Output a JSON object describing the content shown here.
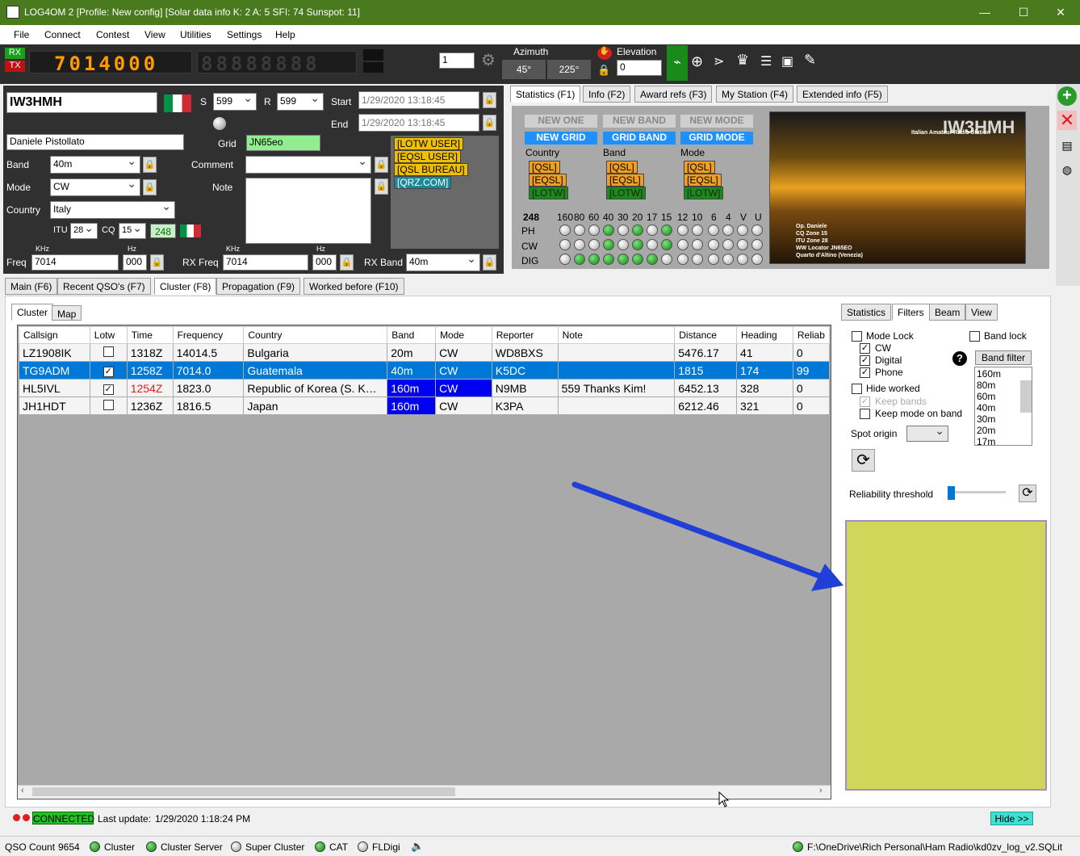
{
  "window": {
    "title": "LOG4OM 2 [Profile: New config] [Solar data info K: 2 A: 5 SFI: 74 Sunspot: 11]",
    "min": "—",
    "max": "☐",
    "close": "✕"
  },
  "menu": [
    "File",
    "Connect",
    "Contest",
    "View",
    "Utilities",
    "Settings",
    "Help"
  ],
  "radio": {
    "rx": "RX",
    "tx": "TX",
    "freq_digits": "7014000",
    "freq2": "88888888",
    "spin": "1",
    "azimuth_label": "Azimuth",
    "az1": "45°",
    "az2": "225°",
    "elevation_label": "Elevation",
    "elevation": "0"
  },
  "qso": {
    "callsign": "IW3HMH",
    "s_label": "S",
    "s": "599",
    "r_label": "R",
    "r": "599",
    "start_label": "Start",
    "start": "1/29/2020 13:18:45",
    "end_label": "End",
    "end": "1/29/2020 13:18:45",
    "name": "Daniele Pistollato",
    "grid_label": "Grid",
    "grid": "JN65eo",
    "band_label": "Band",
    "band": "40m",
    "comment_label": "Comment",
    "comment": "",
    "mode_label": "Mode",
    "mode": "CW",
    "note_label": "Note",
    "country_label": "Country",
    "country": "Italy",
    "itu_label": "ITU",
    "itu": "28",
    "cq_label": "CQ",
    "cq": "15",
    "dxcc": "248",
    "khz": "KHz",
    "hz": "Hz",
    "freq_label": "Freq",
    "freq": "7014",
    "freq_hz": "000",
    "rxfreq_label": "RX Freq",
    "rxfreq": "7014",
    "rxfreq_hz": "000",
    "rxband_label": "RX Band",
    "rxband": "40m",
    "badges": [
      "[LOTW USER]",
      "[EQSL USER]",
      "[QSL BUREAU]",
      "[QRZ.COM]"
    ]
  },
  "right_tabs": [
    "Statistics (F1)",
    "Info (F2)",
    "Award refs (F3)",
    "My Station (F4)",
    "Extended info (F5)"
  ],
  "stats": {
    "new_one": "NEW ONE",
    "new_band": "NEW BAND",
    "new_mode": "NEW MODE",
    "new_grid": "NEW GRID",
    "grid_band": "GRID BAND",
    "grid_mode": "GRID MODE",
    "col_country": "Country",
    "col_band": "Band",
    "col_mode": "Mode",
    "qsl": "[QSL]",
    "eqsl": "[EQSL]",
    "lotw": "[LOTW]",
    "count": "248",
    "bands": [
      "160",
      "80",
      "60",
      "40",
      "30",
      "20",
      "17",
      "15",
      "12",
      "10",
      "6",
      "4",
      "V",
      "U"
    ],
    "rows": [
      {
        "name": "PH",
        "leds": [
          0,
          0,
          0,
          1,
          0,
          1,
          0,
          1,
          0,
          0,
          0,
          0,
          0,
          0
        ]
      },
      {
        "name": "CW",
        "leds": [
          0,
          0,
          0,
          1,
          0,
          1,
          0,
          1,
          0,
          0,
          0,
          0,
          0,
          0
        ]
      },
      {
        "name": "DIG",
        "leds": [
          0,
          1,
          1,
          1,
          1,
          1,
          1,
          0,
          0,
          0,
          0,
          0,
          0,
          0
        ]
      }
    ]
  },
  "qsl_card": {
    "call": "IW3HMH",
    "subtitle": "Italian Amateur Radio Station",
    "lines": [
      "Op. Daniele",
      "CQ Zone 15",
      "ITU Zone 28",
      "WW Locator JN65EO",
      "Quarto d'Altino (Venezia)"
    ]
  },
  "main_tabs": [
    "Main (F6)",
    "Recent QSO's (F7)",
    "Cluster (F8)",
    "Propagation (F9)",
    "Worked before (F10)"
  ],
  "sub_tabs": [
    "Cluster",
    "Map"
  ],
  "table": {
    "headers": [
      "Callsign",
      "Lotw",
      "Time",
      "Frequency",
      "Country",
      "Band",
      "Mode",
      "Reporter",
      "Note",
      "Distance",
      "Heading",
      "Reliab"
    ],
    "rows": [
      {
        "call": "LZ1908IK",
        "lotw": "",
        "time": "1318Z",
        "freq": "14014.5",
        "country": "Bulgaria",
        "band": "20m",
        "mode": "CW",
        "reporter": "WD8BXS",
        "note": "",
        "dist": "5476.17",
        "heading": "41",
        "rel": "0"
      },
      {
        "call": "TG9ADM",
        "lotw": "✓",
        "time": "1258Z",
        "freq": "7014.0",
        "country": "Guatemala",
        "band": "40m",
        "mode": "CW",
        "reporter": "K5DC",
        "note": "",
        "dist": "1815",
        "heading": "174",
        "rel": "99"
      },
      {
        "call": "HL5IVL",
        "lotw": "✓",
        "time": "1254Z",
        "freq": "1823.0",
        "country": "Republic of Korea (S. K…",
        "band": "160m",
        "mode": "CW",
        "reporter": "N9MB",
        "note": "559 Thanks Kim!",
        "dist": "6452.13",
        "heading": "328",
        "rel": "0"
      },
      {
        "call": "JH1HDT",
        "lotw": "",
        "time": "1236Z",
        "freq": "1816.5",
        "country": "Japan",
        "band": "160m",
        "mode": "CW",
        "reporter": "K3PA",
        "note": "",
        "dist": "6212.46",
        "heading": "321",
        "rel": "0"
      }
    ]
  },
  "filters": {
    "tabs": [
      "Statistics",
      "Filters",
      "Beam",
      "View"
    ],
    "mode_lock": "Mode Lock",
    "band_lock": "Band lock",
    "cw": "CW",
    "digital": "Digital",
    "phone": "Phone",
    "hide_worked": "Hide worked",
    "keep_bands": "Keep bands",
    "keep_mode": "Keep mode on band",
    "spot_origin": "Spot origin",
    "band_filter": "Band filter",
    "bands": [
      "160m",
      "80m",
      "60m",
      "40m",
      "30m",
      "20m",
      "17m"
    ],
    "reliability": "Reliability threshold"
  },
  "cluster_status": {
    "connected": "CONNECTED",
    "last_update_label": "Last update:",
    "last_update": "1/29/2020 1:18:24 PM",
    "hide": "Hide >>"
  },
  "statusbar": {
    "qso_count_label": "QSO Count",
    "qso_count": "9654",
    "cluster": "Cluster",
    "cluster_server": "Cluster Server",
    "super_cluster": "Super Cluster",
    "cat": "CAT",
    "fldigi": "FLDigi",
    "db_path": "F:\\OneDrive\\Rich Personal\\Ham Radio\\kd0zv_log_v2.SQLite"
  },
  "colors": {
    "titlebar": "#4a7a1e",
    "highlight_panel": "#cfd659",
    "arrow": "#1f3fd6",
    "selected_row": "#0078d7",
    "band_blue": "#0000f0"
  }
}
